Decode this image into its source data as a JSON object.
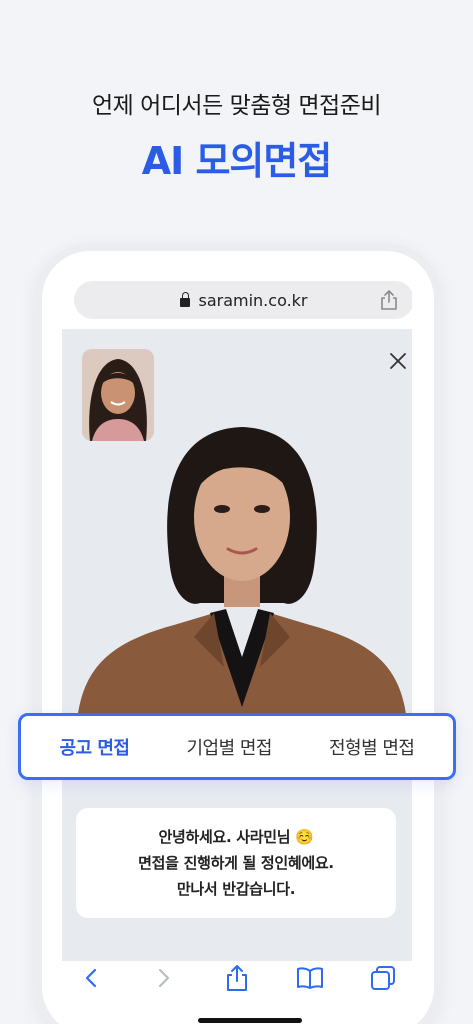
{
  "promo": {
    "headline": "언제 어디서든 맞춤형 면접준비",
    "title": "AI 모의면접"
  },
  "browser": {
    "url": "saramin.co.kr"
  },
  "tabs": [
    {
      "label": "공고 면접",
      "active": true
    },
    {
      "label": "기업별 면접",
      "active": false
    },
    {
      "label": "전형별 면접",
      "active": false
    }
  ],
  "chat": {
    "line1": "안녕하세요. 사라민님 ☺️",
    "line2": "면접을 진행하게 될 정인혜에요.",
    "line3": "만나서 반갑습니다."
  },
  "colors": {
    "accent": "#2b5ce6",
    "background": "#f3f4f7",
    "video_bg": "#e7ebf0"
  },
  "icons": [
    "lock-icon",
    "share-icon",
    "close-icon",
    "back-icon",
    "forward-icon",
    "bookmarks-icon",
    "tabs-icon"
  ]
}
